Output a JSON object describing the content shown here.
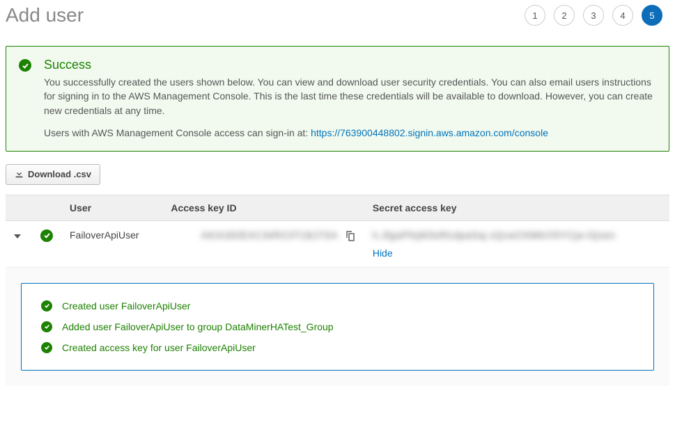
{
  "page_title": "Add user",
  "wizard": {
    "steps": [
      "1",
      "2",
      "3",
      "4",
      "5"
    ],
    "active_index": 4
  },
  "success": {
    "heading": "Success",
    "body": "You successfully created the users shown below. You can view and download user security credentials. You can also email users instructions for signing in to the AWS Management Console. This is the last time these credentials will be available to download. However, you can create new credentials at any time.",
    "signin_prefix": "Users with AWS Management Console access can sign-in at: ",
    "signin_url": "https://763900448802.signin.aws.amazon.com/console"
  },
  "buttons": {
    "download_csv": "Download .csv"
  },
  "table": {
    "headers": {
      "user": "User",
      "access_key_id": "Access key ID",
      "secret_access_key": "Secret access key"
    },
    "rows": [
      {
        "user": "FailoverApiUser",
        "access_key_id_masked": "AKIA3DIEAC34RC0T1BJ7SA",
        "secret_access_key_masked": "h.JfgaPfnjM3sRlcdpaSaj xQcwChlMtrO5YCjw-IQxen",
        "hide_label": "Hide"
      }
    ]
  },
  "events": [
    "Created user FailoverApiUser",
    "Added user FailoverApiUser to group DataMinerHATest_Group",
    "Created access key for user FailoverApiUser"
  ]
}
